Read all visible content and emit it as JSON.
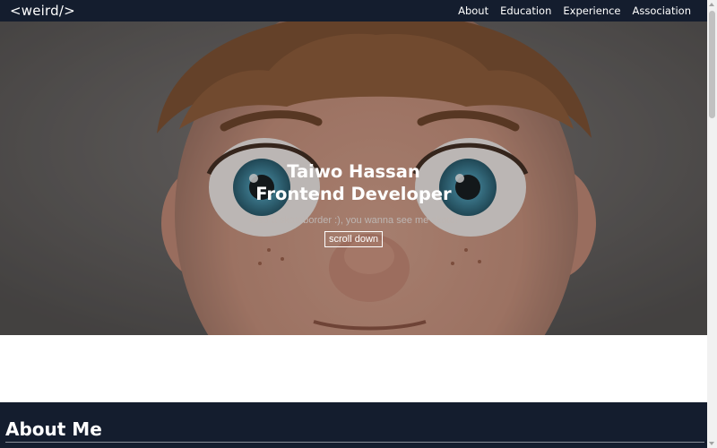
{
  "nav": {
    "brand": "<weird/>",
    "links": [
      "About",
      "Education",
      "Experience",
      "Association"
    ]
  },
  "hero": {
    "name": "Taiwo Hassan",
    "role": "Frontend Developer",
    "subtitle": "Also a skateborder :), you wanna see me skate!",
    "button_label": "scroll down"
  },
  "about": {
    "title": "About Me"
  },
  "colors": {
    "navbar_bg": "#141d2e",
    "section_bg": "#141d2e",
    "text_primary": "#ffffff",
    "hero_subtitle": "#bdb5b2"
  }
}
